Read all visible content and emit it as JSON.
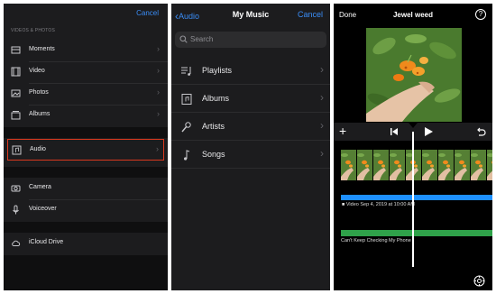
{
  "import_panel": {
    "cancel_label": "Cancel",
    "section_header": "VIDEOS & PHOTOS",
    "items": [
      {
        "label": "Moments",
        "icon": "moments-icon"
      },
      {
        "label": "Video",
        "icon": "film-icon"
      },
      {
        "label": "Photos",
        "icon": "photo-icon"
      },
      {
        "label": "Albums",
        "icon": "albums-icon"
      },
      {
        "label": "Audio",
        "icon": "audio-icon",
        "highlighted": true
      },
      {
        "label": "Camera",
        "icon": "camera-icon"
      },
      {
        "label": "Voiceover",
        "icon": "microphone-icon"
      },
      {
        "label": "iCloud Drive",
        "icon": "cloud-icon"
      }
    ],
    "highlight_color": "#d9381e"
  },
  "music_panel": {
    "back_label": "Audio",
    "title": "My Music",
    "cancel_label": "Cancel",
    "search_placeholder": "Search",
    "items": [
      {
        "label": "Playlists",
        "icon": "playlist-icon"
      },
      {
        "label": "Albums",
        "icon": "album-icon"
      },
      {
        "label": "Artists",
        "icon": "artist-icon"
      },
      {
        "label": "Songs",
        "icon": "note-icon"
      }
    ]
  },
  "editor_panel": {
    "done_label": "Done",
    "title": "Jewel weed",
    "help_label": "?",
    "toolbar": {
      "add_label": "+",
      "icons": [
        "plus-icon",
        "skip-back-icon",
        "play-icon",
        "undo-icon"
      ]
    },
    "timeline": {
      "video_label": "Video Sep 4, 2019 at 10:00 AM",
      "audio_label": "Can't Keep Checking My Phone",
      "video_track_color": "#1e90ff",
      "audio_track_color": "#2fa24a"
    }
  },
  "colors": {
    "accent": "#3a8df7",
    "panel_bg": "#1c1c1e",
    "editor_bg": "#000000"
  }
}
